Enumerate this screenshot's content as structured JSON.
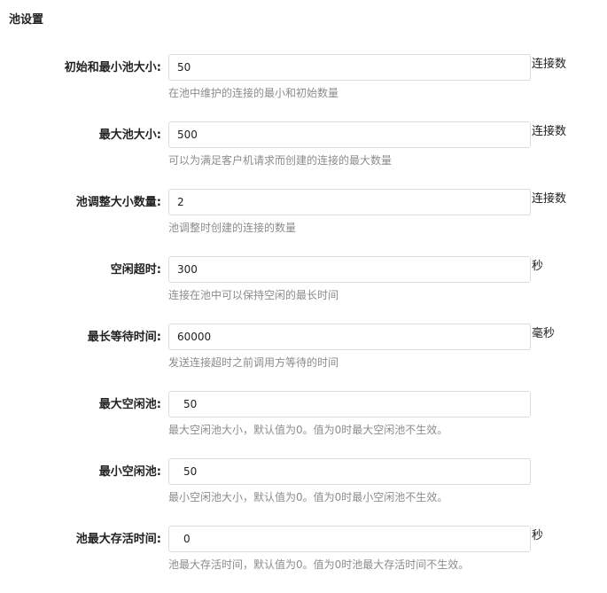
{
  "section": {
    "title": "池设置"
  },
  "fields": [
    {
      "label": "初始和最小池大小:",
      "value": "50",
      "unit": "连接数",
      "hint": "在池中维护的连接的最小和初始数量"
    },
    {
      "label": "最大池大小:",
      "value": "500",
      "unit": "连接数",
      "hint": "可以为满足客户机请求而创建的连接的最大数量"
    },
    {
      "label": "池调整大小数量:",
      "value": "2",
      "unit": "连接数",
      "hint": "池调整时创建的连接的数量"
    },
    {
      "label": "空闲超时:",
      "value": "300",
      "unit": "秒",
      "hint": "连接在池中可以保持空闲的最长时间"
    },
    {
      "label": "最长等待时间:",
      "value": "60000",
      "unit": "毫秒",
      "hint": "发送连接超时之前调用方等待的时间"
    },
    {
      "label": "最大空闲池:",
      "value": "50",
      "unit": "",
      "hint": "最大空闲池大小，默认值为0。值为0时最大空闲池不生效。"
    },
    {
      "label": "最小空闲池:",
      "value": "50",
      "unit": "",
      "hint": "最小空闲池大小，默认值为0。值为0时最小空闲池不生效。"
    },
    {
      "label": "池最大存活时间:",
      "value": "0",
      "unit": "秒",
      "hint": "池最大存活时间，默认值为0。值为0时池最大存活时间不生效。"
    }
  ]
}
